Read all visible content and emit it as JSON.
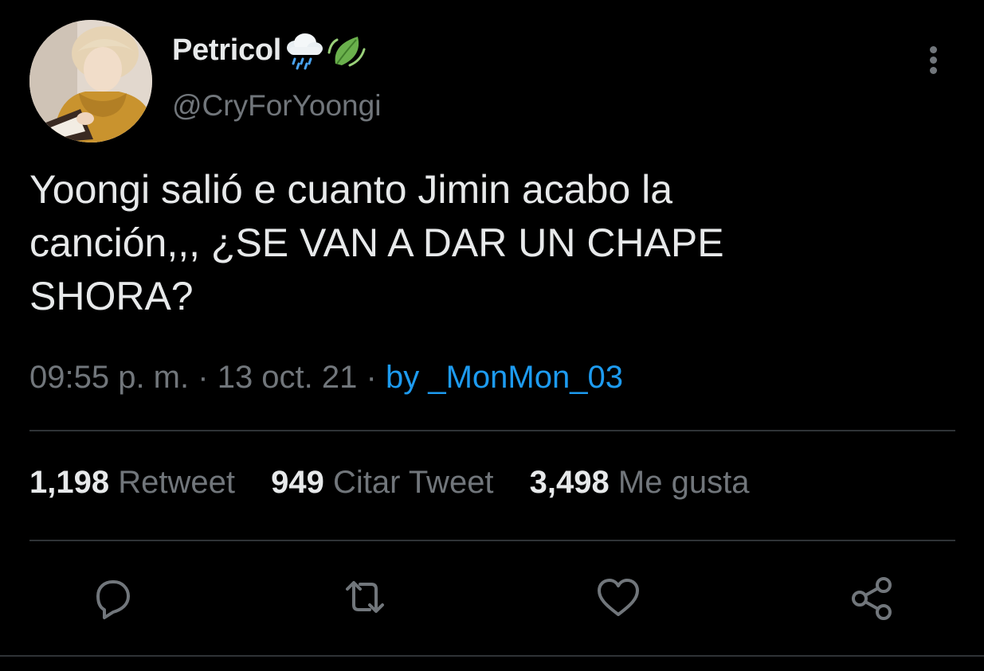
{
  "author": {
    "display_name": "Petricol",
    "name_emojis": [
      "rain-cloud-emoji",
      "leaf-emoji"
    ],
    "handle": "@CryForYoongi"
  },
  "tweet": {
    "text_lines": [
      "Yoongi salió e cuanto Jimin acabo la",
      "canción,,, ¿SE VAN A DAR UN CHAPE",
      "SHORA?"
    ],
    "time": "09:55 p. m.",
    "separator": "·",
    "date": "13 oct. 21",
    "source": "by _MonMon_03"
  },
  "stats": {
    "retweets": {
      "count": "1,198",
      "label": "Retweet"
    },
    "quotes": {
      "count": "949",
      "label": "Citar Tweet"
    },
    "likes": {
      "count": "3,498",
      "label": "Me gusta"
    }
  },
  "actions": [
    "reply-icon",
    "retweet-icon",
    "like-icon",
    "share-icon"
  ],
  "colors": {
    "background": "#000000",
    "text": "#e7e9ea",
    "secondary": "#71767b",
    "accent": "#1d9bf0",
    "divider": "#2f3336"
  }
}
